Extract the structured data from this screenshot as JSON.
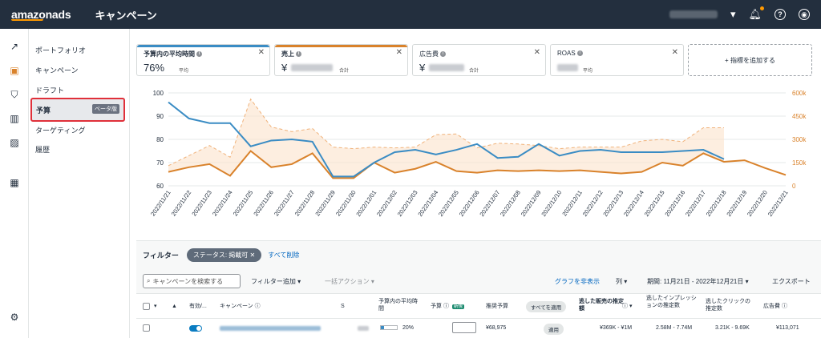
{
  "topbar": {
    "logo": "amazonads",
    "title": "キャンペーン"
  },
  "nav": {
    "items": [
      "ポートフォリオ",
      "キャンペーン",
      "ドラフト",
      "予算",
      "ターゲティング",
      "履歴"
    ],
    "active_badge": "ベータ版"
  },
  "metrics": [
    {
      "name": "予算内の平均時間",
      "value": "76%",
      "unit": "平均",
      "color": "#3a8cc4"
    },
    {
      "name": "売上",
      "value": "¥",
      "unit": "合計",
      "color": "#d9822b"
    },
    {
      "name": "広告費",
      "value": "¥",
      "unit": "合計"
    },
    {
      "name": "ROAS",
      "value": "",
      "unit": "平均"
    }
  ],
  "add_metric": "+ 指標を追加する",
  "chart_data": {
    "type": "line",
    "x": [
      "2022/11/21",
      "2022/11/22",
      "2022/11/23",
      "2022/11/24",
      "2022/11/25",
      "2022/11/26",
      "2022/11/27",
      "2022/11/28",
      "2022/11/29",
      "2022/11/30",
      "2022/12/01",
      "2022/12/02",
      "2022/12/03",
      "2022/12/04",
      "2022/12/05",
      "2022/12/06",
      "2022/12/07",
      "2022/12/08",
      "2022/12/09",
      "2022/12/10",
      "2022/12/11",
      "2022/12/12",
      "2022/12/13",
      "2022/12/14",
      "2022/12/15",
      "2022/12/16",
      "2022/12/17",
      "2022/12/18",
      "2022/12/19",
      "2022/12/20",
      "2022/12/21"
    ],
    "left_axis": {
      "ticks": [
        "100",
        "90",
        "80",
        "70",
        "60"
      ],
      "ylim": [
        60,
        100
      ]
    },
    "right_axis": {
      "ticks": [
        "600k",
        "450k",
        "300k",
        "150k",
        "0"
      ],
      "ylim": [
        0,
        600000
      ]
    },
    "series": [
      {
        "axis": "left",
        "color": "#3a8cc4",
        "values": [
          96,
          89,
          87,
          87,
          77,
          79.5,
          80,
          79,
          64,
          64,
          70,
          74.5,
          75.5,
          73.5,
          75.5,
          78,
          72,
          72.5,
          78,
          73,
          75,
          75.5,
          74.5,
          74.5,
          74.5,
          75,
          75.5,
          71.5,
          null,
          null,
          null
        ]
      },
      {
        "axis": "right",
        "color": "#d9822b",
        "values": [
          90000,
          120000,
          140000,
          65000,
          225000,
          120000,
          140000,
          210000,
          50000,
          50000,
          150000,
          85000,
          110000,
          155000,
          95000,
          85000,
          100000,
          95000,
          100000,
          95000,
          100000,
          90000,
          80000,
          90000,
          150000,
          130000,
          210000,
          155000,
          165000,
          115000,
          70000
        ]
      },
      {
        "axis": "right",
        "color": "#f0b27a",
        "style": "dashed",
        "values": [
          130000,
          195000,
          260000,
          185000,
          560000,
          380000,
          350000,
          370000,
          250000,
          240000,
          250000,
          245000,
          250000,
          330000,
          335000,
          245000,
          275000,
          270000,
          260000,
          240000,
          250000,
          250000,
          250000,
          290000,
          300000,
          285000,
          375000,
          375000,
          null,
          null,
          null
        ]
      }
    ]
  },
  "filter": {
    "label": "フィルター",
    "chip": "ステータス: 掲載可",
    "clear": "すべて削除"
  },
  "toolbar": {
    "search_placeholder": "キャンペーンを検索する",
    "add_filter": "フィルター追加",
    "bulk": "一括アクション",
    "hide_graph": "グラフを非表示",
    "columns": "列",
    "period": "期間: 11月21日 - 2022年12月21日",
    "export": "エクスポート"
  },
  "table": {
    "headers": {
      "active": "有効/...",
      "campaign": "キャンペーン",
      "s": "S",
      "avg_time": "予算内の平均時間",
      "budget": "予算",
      "new_badge": "新規",
      "rec_budget": "推奨予算",
      "apply_all": "すべてを適用",
      "lost_sales": "逃した販売の推定額",
      "lost_impr": "逃したインプレッションの推定数",
      "lost_clicks": "逃したクリックの推定数",
      "ad_spend": "広告費"
    },
    "row": {
      "pct": "20%",
      "rec": "¥68,975",
      "apply": "適用",
      "lost_sales": "¥369K - ¥1M",
      "lost_impr": "2.58M - 7.74M",
      "lost_clicks": "3.21K - 9.69K",
      "ad_spend": "¥113,071"
    }
  }
}
